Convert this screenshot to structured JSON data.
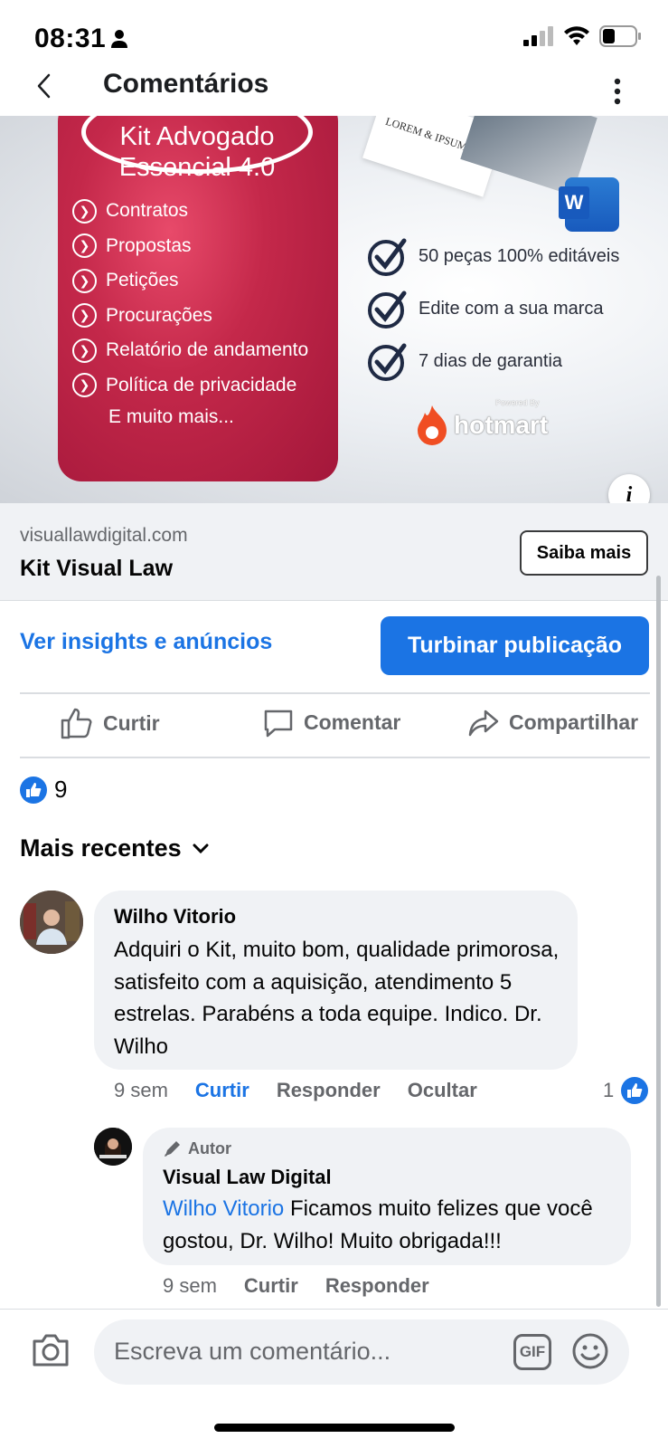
{
  "status_bar": {
    "time": "08:31"
  },
  "header": {
    "title": "Comentários"
  },
  "ad": {
    "card_title_line1": "Kit Advogado",
    "card_title_line2": "Essencial 4.0",
    "card_items": [
      "Contratos",
      "Propostas",
      "Petições",
      "Procurações",
      "Relatório de andamento",
      "Política de privacidade"
    ],
    "card_more": "E muito mais...",
    "paper_text": "LOREM & IPSUM",
    "word_letter": "W",
    "checks": [
      "50 peças 100% editáveis",
      "Edite com a sua marca",
      "7 dias de garantia"
    ],
    "hotmart": "hotmart",
    "hotmart_powered": "Powered By",
    "info": "i"
  },
  "link_preview": {
    "domain": "visuallawdigital.com",
    "title": "Kit Visual Law",
    "cta": "Saiba mais"
  },
  "post_actions": {
    "insights": "Ver insights e anúncios",
    "boost": "Turbinar publicação",
    "like": "Curtir",
    "comment": "Comentar",
    "share": "Compartilhar"
  },
  "reactions": {
    "count": "9"
  },
  "sort": {
    "label": "Mais recentes"
  },
  "comments": [
    {
      "author": "Wilho Vitorio",
      "text": "Adquiri o Kit,  muito bom, qualidade primorosa, satisfeito com a aquisição, atendimento 5 estrelas. Parabéns a toda equipe. Indico. Dr. Wilho",
      "time": "9 sem",
      "like": "Curtir",
      "reply": "Responder",
      "hide": "Ocultar",
      "like_count": "1"
    }
  ],
  "reply": {
    "badge": "Autor",
    "author": "Visual Law Digital",
    "mention": "Wilho Vitorio",
    "text": " Ficamos muito felizes que você gostou, Dr. Wilho! Muito obrigada!!!",
    "time": "9 sem",
    "like": "Curtir",
    "reply": "Responder"
  },
  "composer": {
    "placeholder": "Escreva um comentário...",
    "gif": "GIF"
  },
  "colors": {
    "accent": "#1b74e4",
    "card": "#c4284a",
    "bubble": "#f0f2f5",
    "muted": "#65676b"
  },
  "icons": [
    "person-icon",
    "signal-icon",
    "wifi-icon",
    "battery-icon",
    "back-icon",
    "more-icon",
    "like-icon",
    "comment-icon",
    "share-icon",
    "chevron-down-icon",
    "pencil-icon",
    "camera-icon",
    "gif-icon",
    "emoji-icon"
  ]
}
